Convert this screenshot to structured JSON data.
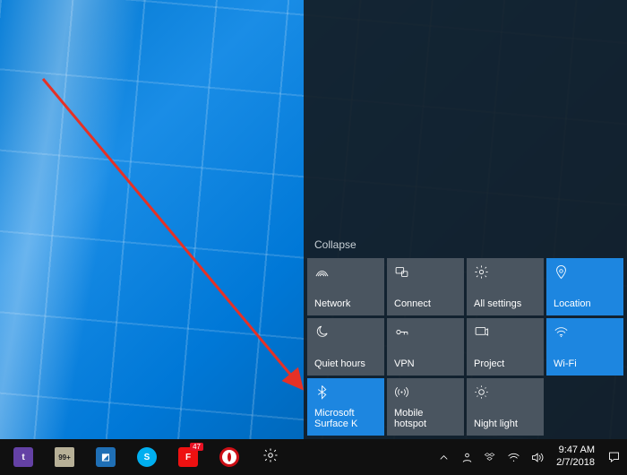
{
  "action_center": {
    "collapse_label": "Collapse",
    "tiles": [
      {
        "id": "network",
        "label": "Network",
        "accent": false,
        "icon": "network-icon"
      },
      {
        "id": "connect",
        "label": "Connect",
        "accent": false,
        "icon": "connect-icon"
      },
      {
        "id": "all-settings",
        "label": "All settings",
        "accent": false,
        "icon": "gear-icon"
      },
      {
        "id": "location",
        "label": "Location",
        "accent": true,
        "icon": "location-icon"
      },
      {
        "id": "quiet-hours",
        "label": "Quiet hours",
        "accent": false,
        "icon": "moon-icon"
      },
      {
        "id": "vpn",
        "label": "VPN",
        "accent": false,
        "icon": "vpn-icon"
      },
      {
        "id": "project",
        "label": "Project",
        "accent": false,
        "icon": "project-icon"
      },
      {
        "id": "wifi",
        "label": "Wi-Fi",
        "accent": true,
        "icon": "wifi-icon"
      },
      {
        "id": "bluetooth",
        "label": "Microsoft Surface K",
        "accent": true,
        "icon": "bluetooth-icon"
      },
      {
        "id": "mobile-hotspot",
        "label": "Mobile hotspot",
        "accent": false,
        "icon": "hotspot-icon"
      },
      {
        "id": "night-light",
        "label": "Night light",
        "accent": false,
        "icon": "sun-icon"
      }
    ]
  },
  "taskbar": {
    "apps": [
      {
        "id": "twitch",
        "name": "twitch-app",
        "badge": ""
      },
      {
        "id": "folder",
        "name": "file-explorer",
        "badge": "99+"
      },
      {
        "id": "photos",
        "name": "photos-app",
        "badge": ""
      },
      {
        "id": "skype",
        "name": "skype-app",
        "badge": ""
      },
      {
        "id": "mail",
        "name": "mail-app",
        "badge": "47"
      },
      {
        "id": "opera",
        "name": "opera-browser",
        "badge": ""
      },
      {
        "id": "settings",
        "name": "settings-app",
        "badge": ""
      }
    ],
    "tray": {
      "time": "9:47 AM",
      "date": "2/7/2018"
    }
  }
}
